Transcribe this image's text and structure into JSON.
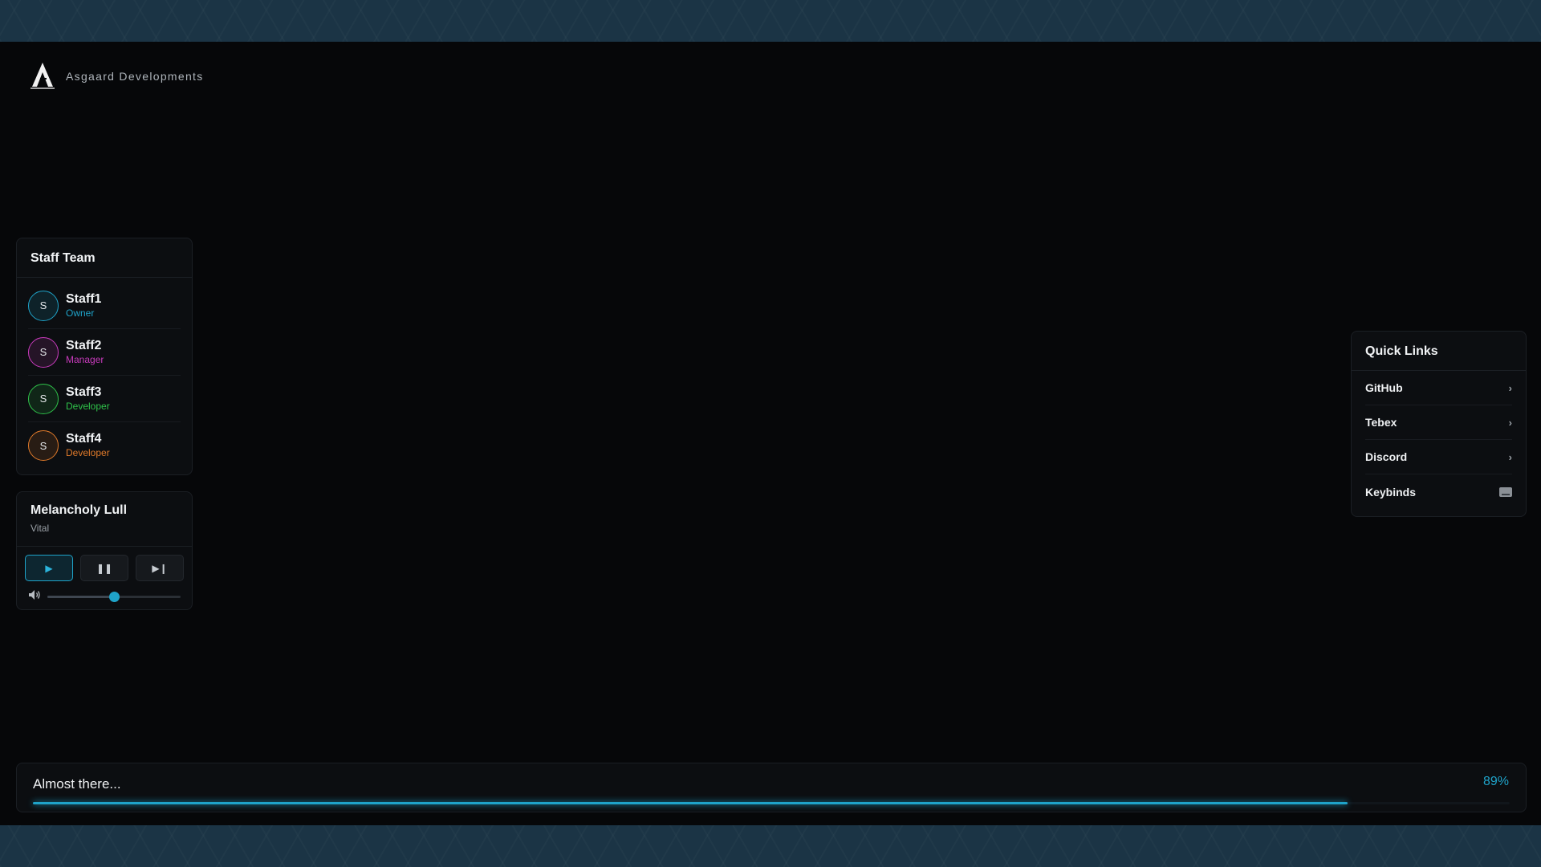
{
  "brand": {
    "name": "Asgaard Developments"
  },
  "staff": {
    "title": "Staff Team",
    "members": [
      {
        "initial": "S",
        "name": "Staff1",
        "role": "Owner",
        "color": "#1fa3c9"
      },
      {
        "initial": "S",
        "name": "Staff2",
        "role": "Manager",
        "color": "#c93bbd"
      },
      {
        "initial": "S",
        "name": "Staff3",
        "role": "Developer",
        "color": "#2fc24a"
      },
      {
        "initial": "S",
        "name": "Staff4",
        "role": "Developer",
        "color": "#e07a2a"
      }
    ]
  },
  "music": {
    "title": "Melancholy Lull",
    "artist": "Vital",
    "controls": [
      "play-icon",
      "pause-icon",
      "skip-next-icon"
    ],
    "volume": 0.5
  },
  "links": {
    "title": "Quick Links",
    "items": [
      {
        "label": "GitHub",
        "icon": "chevron-right-icon"
      },
      {
        "label": "Tebex",
        "icon": "chevron-right-icon"
      },
      {
        "label": "Discord",
        "icon": "chevron-right-icon"
      },
      {
        "label": "Keybinds",
        "icon": "keyboard-icon"
      }
    ]
  },
  "loading": {
    "status": "Almost there...",
    "percent_label": "89%",
    "progress": 0.89,
    "accent": "#1fa3c9"
  }
}
